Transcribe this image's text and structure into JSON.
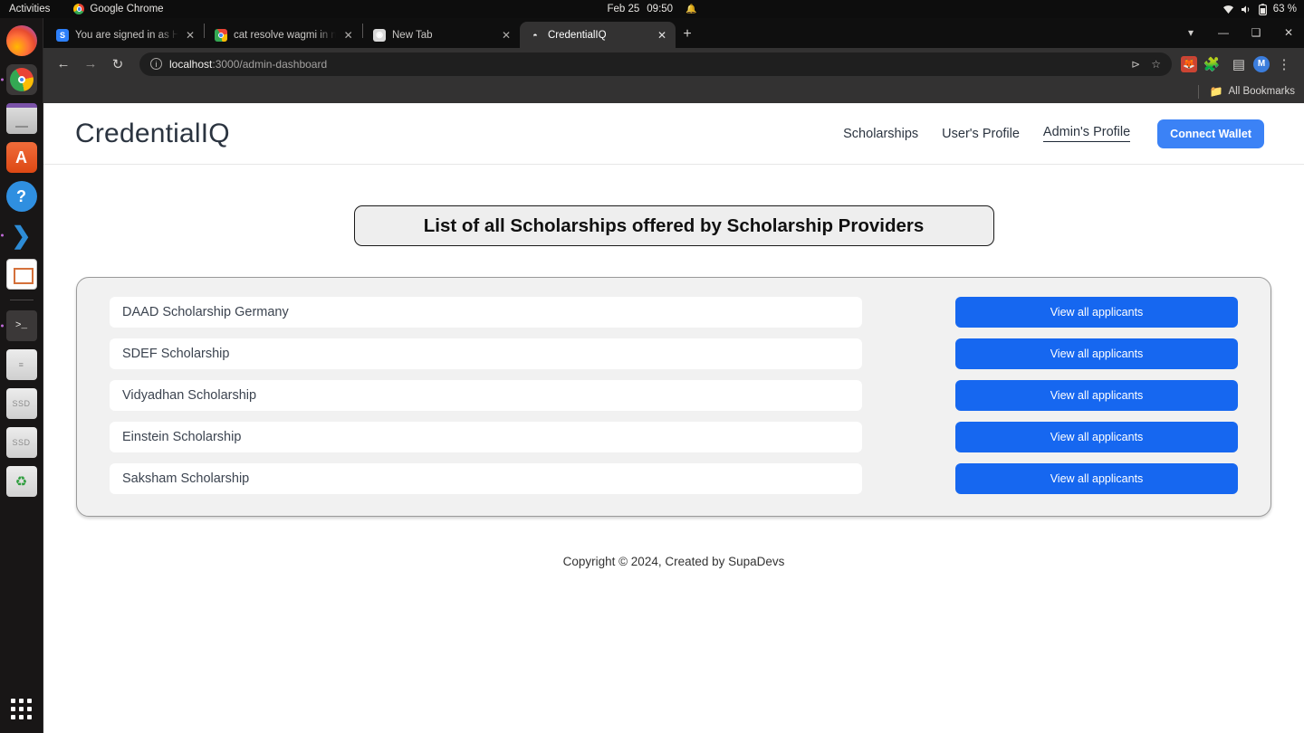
{
  "desktop": {
    "activities": "Activities",
    "app_name": "Google Chrome",
    "clock_date": "Feb 25",
    "clock_time": "09:50",
    "battery": "63 %",
    "dock": [
      {
        "name": "firefox",
        "label": "Firefox",
        "running": false
      },
      {
        "name": "google-chrome",
        "label": "Google Chrome",
        "running": true
      },
      {
        "name": "files",
        "label": "Files",
        "running": false
      },
      {
        "name": "ubuntu-software",
        "label": "Ubuntu Software",
        "running": false
      },
      {
        "name": "help",
        "label": "Help",
        "running": false
      },
      {
        "name": "vscode",
        "label": "Visual Studio Code",
        "running": true
      },
      {
        "name": "libreoffice-impress",
        "label": "LibreOffice Impress",
        "running": false
      },
      {
        "name": "terminal",
        "label": "Terminal",
        "running": true
      },
      {
        "name": "disks",
        "label": "Disks",
        "running": false
      },
      {
        "name": "ssd-volume-1",
        "label": "SSD",
        "running": false
      },
      {
        "name": "ssd-volume-2",
        "label": "SSD",
        "running": false
      },
      {
        "name": "trash",
        "label": "Trash",
        "running": false
      }
    ],
    "show_apps_label": "Show Applications"
  },
  "browser": {
    "tabs": [
      {
        "title": "You are signed in as Hack",
        "favicon": "slack-icon",
        "active": false
      },
      {
        "title": "cat resolve wagmi in nex",
        "favicon": "chrome-icon",
        "active": false
      },
      {
        "title": "New Tab",
        "favicon": "globe-icon",
        "active": false
      },
      {
        "title": "CredentialIQ",
        "favicon": "nextjs-icon",
        "active": true
      }
    ],
    "new_tab_label": "+",
    "window_controls": {
      "tab_search": "tab-search-icon",
      "minimize": "minimize-icon",
      "maximize": "maximize-icon",
      "close": "close-icon"
    },
    "toolbar": {
      "back": "back-arrow-icon",
      "forward": "forward-arrow-icon",
      "reload": "reload-icon",
      "site_info": "site-info-icon",
      "url_host": "localhost",
      "url_path": ":3000/admin-dashboard",
      "share": "share-icon",
      "bookmark": "star-icon",
      "extensions": [
        {
          "name": "metamask-extension-icon",
          "glyph": "⬛"
        },
        {
          "name": "extensions-puzzle-icon",
          "glyph": "🧩"
        },
        {
          "name": "side-panel-icon",
          "glyph": "◧"
        }
      ],
      "profile_initial": "M",
      "menu": "three-dot-menu-icon"
    },
    "bookmarks_bar": {
      "folder_icon": "folder-icon",
      "label": "All Bookmarks"
    }
  },
  "page": {
    "brand": "CredentialIQ",
    "nav": [
      {
        "label": "Scholarships",
        "active": false
      },
      {
        "label": "User's Profile",
        "active": false
      },
      {
        "label": "Admin's Profile",
        "active": true
      }
    ],
    "connect_wallet_label": "Connect Wallet",
    "banner_title": "List of all Scholarships offered by Scholarship Providers",
    "scholarships": [
      {
        "name": "DAAD Scholarship Germany",
        "action": "View all applicants"
      },
      {
        "name": "SDEF Scholarship",
        "action": "View all applicants"
      },
      {
        "name": "Vidyadhan Scholarship",
        "action": "View all applicants"
      },
      {
        "name": "Einstein Scholarship",
        "action": "View all applicants"
      },
      {
        "name": "Saksham Scholarship",
        "action": "View all applicants"
      }
    ],
    "footer": "Copyright © 2024, Created by SupaDevs",
    "colors": {
      "accent_blue": "#1667f0",
      "wallet_blue": "#3b82f6",
      "card_bg": "#f1f1f1",
      "banner_bg": "#eeeeee"
    }
  }
}
